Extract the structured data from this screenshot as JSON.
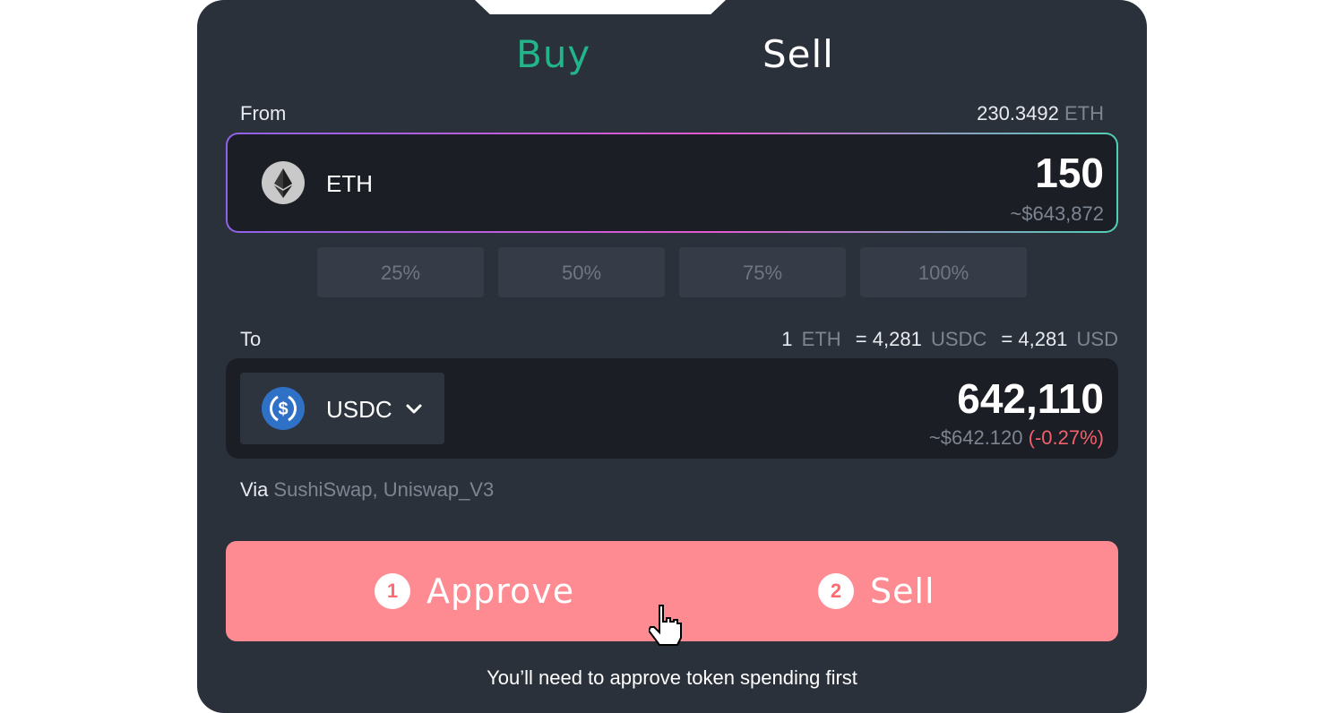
{
  "tabs": {
    "buy": "Buy",
    "sell": "Sell"
  },
  "from": {
    "label": "From",
    "balance_value": "230.3492",
    "balance_unit": "ETH",
    "token": "ETH",
    "token_icon": "ethereum-icon",
    "amount": "150",
    "usd_value": "~$643,872"
  },
  "percent_buttons": [
    "25%",
    "50%",
    "75%",
    "100%"
  ],
  "to": {
    "label": "To",
    "rate": {
      "eth_qty": "1",
      "eth_unit": "ETH",
      "usdc_eq": "= 4,281",
      "usdc_unit": "USDC",
      "usd_eq": "= 4,281",
      "usd_unit": "USD"
    },
    "token": "USDC",
    "token_icon": "usdc-icon",
    "amount": "642,110",
    "usd_value": "~$642.120",
    "change": "(-0.27%)"
  },
  "via": {
    "label": "Via",
    "routes": "SushiSwap, Uniswap_V3"
  },
  "actions": {
    "step1_num": "1",
    "step1_label": "Approve",
    "step2_num": "2",
    "step2_label": "Sell",
    "color": "#fd8b91"
  },
  "note": "You’ll need to approve token spending first",
  "colors": {
    "buy_tab": "#22b58a",
    "negative": "#f2606b",
    "card_bg": "#2b313b"
  }
}
